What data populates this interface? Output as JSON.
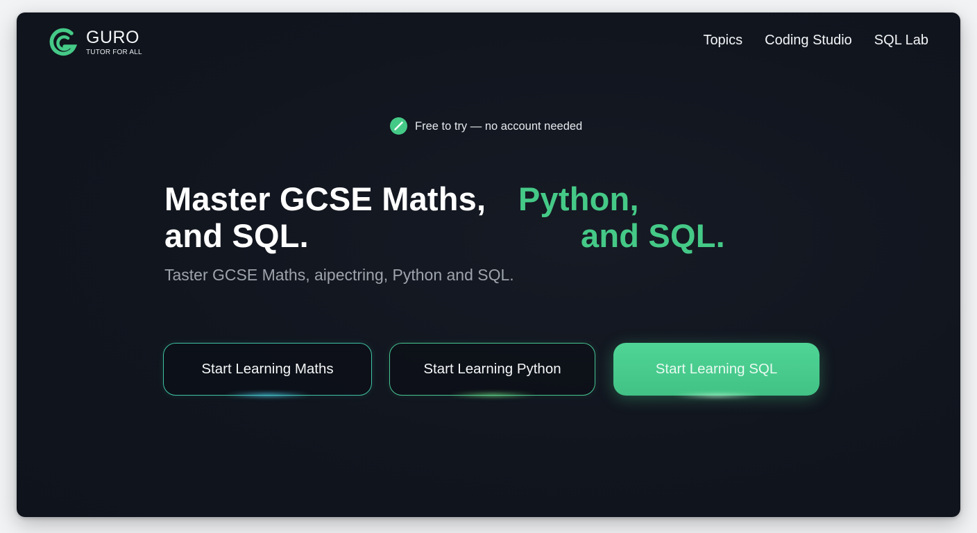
{
  "brand": {
    "name": "GURO",
    "tagline": "TUTOR FOR ALL",
    "accent_color": "#45c987",
    "icon": "guro-logo-icon"
  },
  "nav": {
    "items": [
      {
        "label": "Topics"
      },
      {
        "label": "Coding Studio"
      },
      {
        "label": "SQL Lab"
      }
    ]
  },
  "hero": {
    "badge": {
      "icon": "check-slash-icon",
      "text": "Free to try — no account needed"
    },
    "headline": {
      "line1_white": "Master GCSE Maths,",
      "line1_green": "Python,",
      "line2_white": "and SQL.",
      "line2_green": "and SQL."
    },
    "subheadline": "Taster GCSE Maths, aipectring, Python and SQL."
  },
  "cta": {
    "maths_label": "Start Learning Maths",
    "python_label": "Start Learning Python",
    "sql_label": "Start Learning SQL"
  },
  "colors": {
    "background": "#11151e",
    "primary_green": "#45c987",
    "maths_border": "#3fc4a6",
    "python_border": "#46c793"
  }
}
